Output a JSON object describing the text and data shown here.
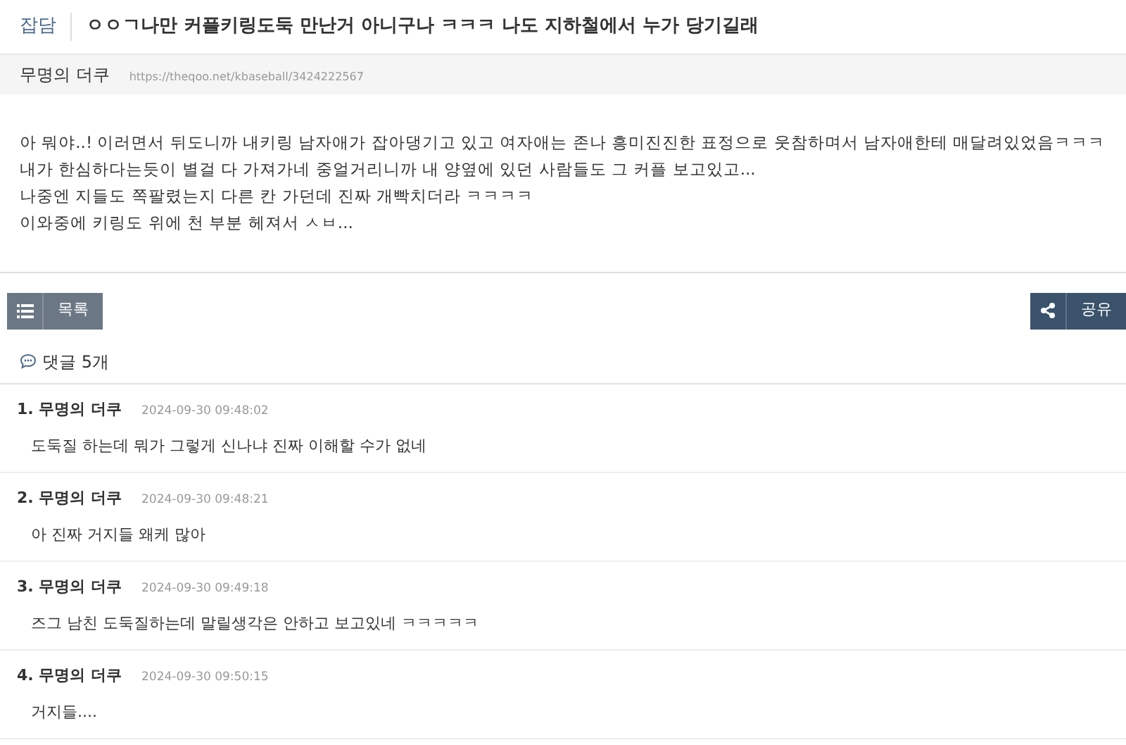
{
  "post": {
    "category": "잡담",
    "title": "ㅇㅇㄱ나만 커플키링도둑 만난거 아니구나 ㅋㅋㅋ 나도 지하철에서 누가 당기길래",
    "author": "무명의 더쿠",
    "url": "https://theqoo.net/kbaseball/3424222567",
    "body": [
      "아 뭐야..! 이러면서 뒤도니까 내키링 남자애가 잡아댕기고 있고 여자애는 존나 흥미진진한 표정으로 웃참하며서 남자애한테 매달려있었음ㅋㅋㅋ",
      "내가 한심하다는듯이 별걸 다 가져가네 중얼거리니까 내 양옆에 있던 사람들도 그 커플 보고있고...",
      "나중엔 지들도 쪽팔렸는지 다른 칸 가던데 진짜 개빡치더라 ㅋㅋㅋㅋ",
      "이와중에 키링도 위에 천 부분 헤져서 ㅅㅂ..."
    ]
  },
  "buttons": {
    "list": "목록",
    "share": "공유"
  },
  "comment_count": "댓글 5개",
  "comments": [
    {
      "number": "1.",
      "author": "무명의 더쿠",
      "time": "2024-09-30 09:48:02",
      "text": "도둑질 하는데 뭐가 그렇게 신나냐 진짜 이해할 수가 없네"
    },
    {
      "number": "2.",
      "author": "무명의 더쿠",
      "time": "2024-09-30 09:48:21",
      "text": "아 진짜 거지들 왜케 많아"
    },
    {
      "number": "3.",
      "author": "무명의 더쿠",
      "time": "2024-09-30 09:49:18",
      "text": "즈그 남친 도둑질하는데 말릴생각은 안하고 보고있네 ㅋㅋㅋㅋㅋ"
    },
    {
      "number": "4.",
      "author": "무명의 더쿠",
      "time": "2024-09-30 09:50:15",
      "text": "거지들...."
    }
  ]
}
